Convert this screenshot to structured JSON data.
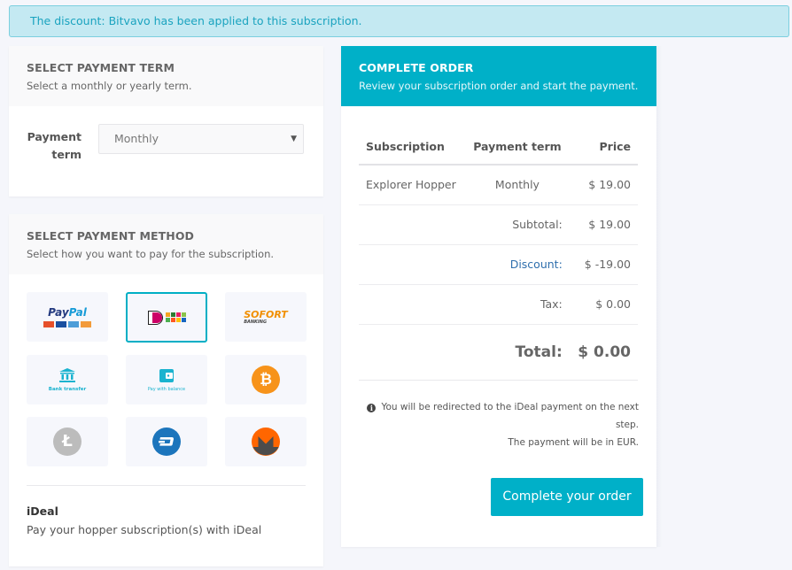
{
  "alert": {
    "text": "The discount: Bitvavo has been applied to this subscription."
  },
  "term_card": {
    "title": "SELECT PAYMENT TERM",
    "subtitle": "Select a monthly or yearly term.",
    "field_label": "Payment term",
    "selected_value": "Monthly",
    "caret": "▼"
  },
  "method_card": {
    "title": "SELECT PAYMENT METHOD",
    "subtitle": "Select how you want to pay for the subscription.",
    "methods": [
      {
        "name": "PayPal",
        "icon": "paypal-logo",
        "selected": false
      },
      {
        "name": "iDeal",
        "icon": "ideal-logo",
        "selected": true
      },
      {
        "name": "Sofort Banking",
        "icon": "sofort-logo",
        "label_main": "SOFORT",
        "label_sub": "BANKING",
        "selected": false
      },
      {
        "name": "Bank transfer",
        "icon": "bank-icon",
        "label": "Bank transfer",
        "selected": false
      },
      {
        "name": "Pay with balance",
        "icon": "wallet-icon",
        "label": "Pay with balance",
        "selected": false
      },
      {
        "name": "Bitcoin",
        "icon": "bitcoin-icon",
        "glyph": "₿",
        "selected": false
      },
      {
        "name": "Litecoin",
        "icon": "litecoin-icon",
        "glyph": "Ł",
        "selected": false
      },
      {
        "name": "Dash",
        "icon": "dash-icon",
        "selected": false
      },
      {
        "name": "Monero",
        "icon": "monero-icon",
        "selected": false
      }
    ],
    "paypal_text": {
      "pay": "Pay",
      "pal": "Pal"
    },
    "selected_name": "iDeal",
    "selected_desc": "Pay your hopper subscription(s) with iDeal"
  },
  "order_card": {
    "title": "COMPLETE ORDER",
    "subtitle": "Review your subscription order and start the payment.",
    "columns": [
      "Subscription",
      "Payment term",
      "Price"
    ],
    "rows": [
      {
        "subscription": "Explorer Hopper",
        "term": "Monthly",
        "price": "$ 19.00"
      }
    ],
    "subtotal_label": "Subtotal:",
    "subtotal": "$ 19.00",
    "discount_label": "Discount:",
    "discount": "$ -19.00",
    "tax_label": "Tax:",
    "tax": "$ 0.00",
    "total_label": "Total:",
    "total": "$ 0.00",
    "info_line1": "You will be redirected to the iDeal payment on the next step.",
    "info_line2": "The payment will be in EUR.",
    "cta": "Complete your order"
  },
  "colors": {
    "accent": "#00b0c8",
    "alert_bg": "#c4e9f2",
    "discount": "#2f6fad"
  }
}
